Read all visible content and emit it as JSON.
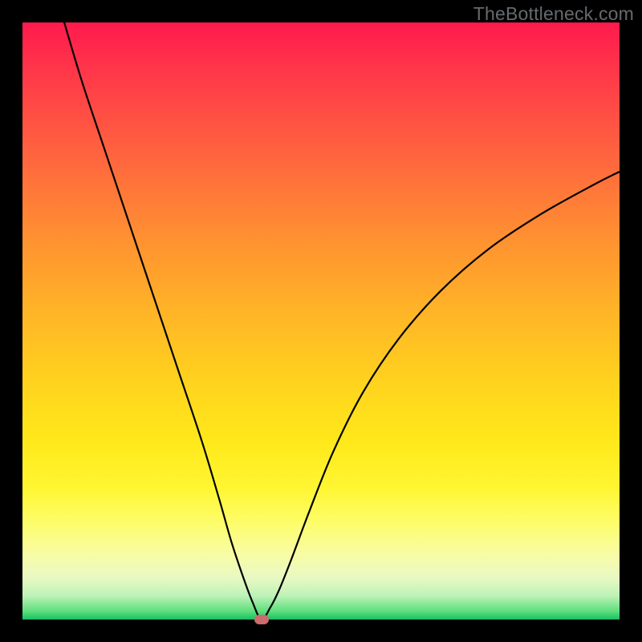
{
  "watermark": "TheBottleneck.com",
  "colors": {
    "frame": "#000000",
    "curve": "#000000",
    "dot": "#cd6b6f",
    "gradient_top": "#ff1a4d",
    "gradient_bottom": "#18c060"
  },
  "chart_data": {
    "type": "line",
    "title": "",
    "xlabel": "",
    "ylabel": "",
    "xlim": [
      0,
      100
    ],
    "ylim": [
      0,
      100
    ],
    "annotations": [
      {
        "type": "marker",
        "x": 40,
        "y": 0,
        "label": "optimal-point"
      }
    ],
    "series": [
      {
        "name": "bottleneck-curve",
        "x": [
          7,
          10,
          14,
          18,
          22,
          26,
          30,
          33,
          35,
          37,
          38.5,
          40,
          41.5,
          43,
          45,
          48,
          52,
          57,
          63,
          70,
          78,
          87,
          96,
          100
        ],
        "y": [
          100,
          90,
          78,
          66,
          54,
          42,
          30,
          20,
          13,
          7,
          3,
          0,
          2,
          5,
          10,
          18,
          28,
          38,
          47,
          55,
          62,
          68,
          73,
          75
        ]
      }
    ],
    "background_gradient": {
      "stops": [
        {
          "pos": 0,
          "color": "#ff1a4d"
        },
        {
          "pos": 0.48,
          "color": "#ffb327"
        },
        {
          "pos": 0.78,
          "color": "#fff632"
        },
        {
          "pos": 1.0,
          "color": "#18c060"
        }
      ]
    }
  }
}
